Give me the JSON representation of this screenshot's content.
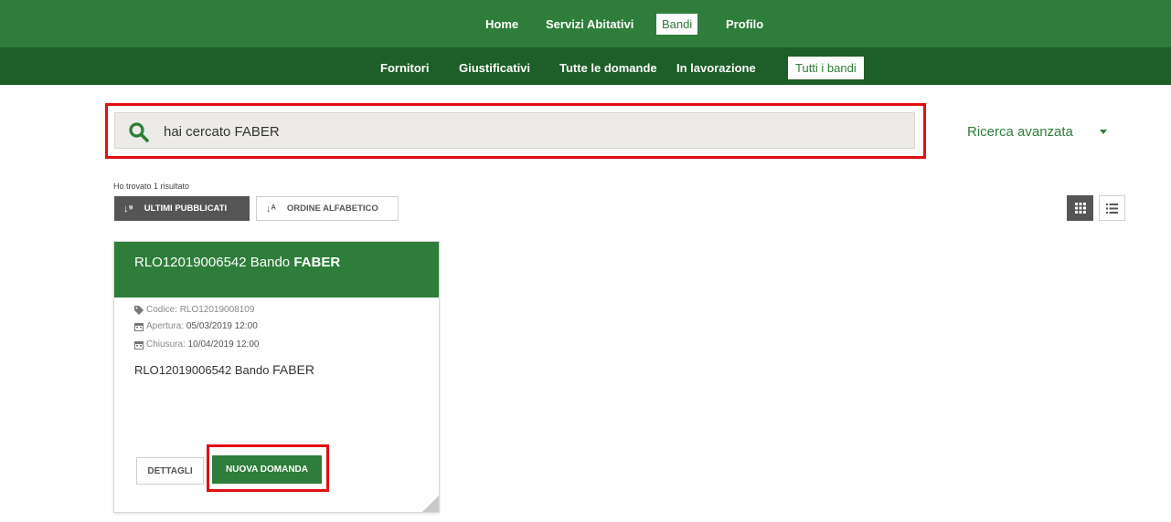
{
  "nav": {
    "main": [
      {
        "label": "Home",
        "active": false
      },
      {
        "label": "Servizi Abitativi",
        "active": false
      },
      {
        "label": "Bandi",
        "active": true
      },
      {
        "label": "Profilo",
        "active": false
      }
    ],
    "sub": [
      {
        "label": "Fornitori",
        "active": false
      },
      {
        "label": "Giustificativi",
        "active": false
      },
      {
        "label": "Tutte le domande",
        "active": false
      },
      {
        "label": "In lavorazione",
        "active": false
      },
      {
        "label": "Tutti i bandi",
        "active": true
      }
    ]
  },
  "search": {
    "text": "hai cercato FABER",
    "advanced_label": "Ricerca avanzata"
  },
  "results": {
    "count_text": "Ho trovato 1 risultato",
    "sort_latest": "ULTIMI PUBBLICATI",
    "sort_alpha": "ORDINE ALFABETICO"
  },
  "card": {
    "title_prefix": "RLO12019006542 Bando ",
    "title_bold": "FABER",
    "codice_label": "Codice:",
    "codice_value": "RLO12019008109",
    "apertura_label": "Apertura:",
    "apertura_value": "05/03/2019 12:00",
    "chiusura_label": "Chiusura:",
    "chiusura_value": "10/04/2019 12:00",
    "desc_prefix": "RLO12019006542 Bando ",
    "desc_word": "FABER",
    "btn_details": "DETTAGLI",
    "btn_new": "NUOVA DOMANDA"
  },
  "colors": {
    "primary_green": "#2e7d3a",
    "dark_green": "#1e5e28",
    "highlight_red": "#e01010"
  }
}
